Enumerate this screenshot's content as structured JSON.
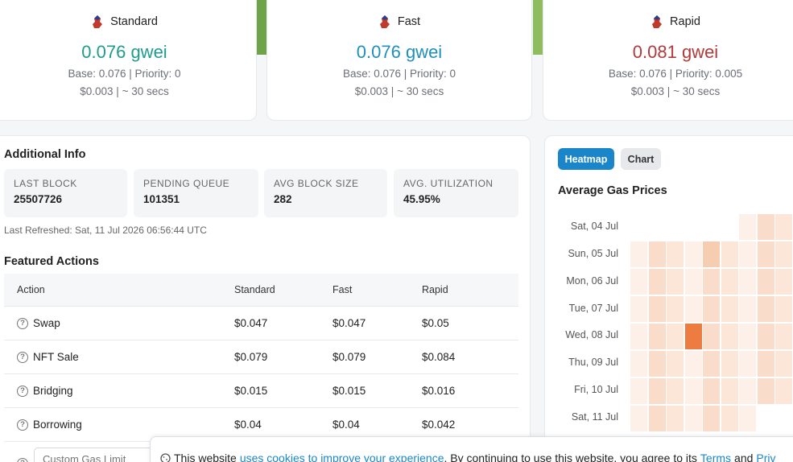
{
  "gas_cards": [
    {
      "name": "Standard",
      "price": "0.076 gwei",
      "base": "Base: 0.076 | Priority: 0",
      "usd": "$0.003 | ~ 30 secs",
      "color": "#1f9c8e"
    },
    {
      "name": "Fast",
      "price": "0.076 gwei",
      "base": "Base: 0.076 | Priority: 0",
      "usd": "$0.003 | ~ 30 secs",
      "color": "#1f8fbf"
    },
    {
      "name": "Rapid",
      "price": "0.081 gwei",
      "base": "Base: 0.076 | Priority: 0.005",
      "usd": "$0.003 | ~ 30 secs",
      "color": "#b23a3a"
    }
  ],
  "additional_info": {
    "title": "Additional Info",
    "stats": [
      {
        "label": "LAST BLOCK",
        "value": "25507726"
      },
      {
        "label": "PENDING QUEUE",
        "value": "101351"
      },
      {
        "label": "AVG BLOCK SIZE",
        "value": "282"
      },
      {
        "label": "AVG. UTILIZATION",
        "value": "45.95%"
      }
    ],
    "last_refreshed": "Last Refreshed: Sat, 11 Jul 2026 06:56:44 UTC"
  },
  "featured_actions": {
    "title": "Featured Actions",
    "columns": [
      "Action",
      "Standard",
      "Fast",
      "Rapid"
    ],
    "rows": [
      {
        "action": "Swap",
        "standard": "$0.047",
        "fast": "$0.047",
        "rapid": "$0.05"
      },
      {
        "action": "NFT Sale",
        "standard": "$0.079",
        "fast": "$0.079",
        "rapid": "$0.084"
      },
      {
        "action": "Bridging",
        "standard": "$0.015",
        "fast": "$0.015",
        "rapid": "$0.016"
      },
      {
        "action": "Borrowing",
        "standard": "$0.04",
        "fast": "$0.04",
        "rapid": "$0.042"
      }
    ],
    "custom_placeholder": "Custom Gas Limit"
  },
  "heatmap": {
    "tabs": [
      "Heatmap",
      "Chart"
    ],
    "active_tab": "Heatmap",
    "title": "Average Gas Prices",
    "days": [
      "Sat, 04 Jul",
      "Sun, 05 Jul",
      "Mon, 06 Jul",
      "Tue, 07 Jul",
      "Wed, 08 Jul",
      "Thu, 09 Jul",
      "Fri, 10 Jul",
      "Sat, 11 Jul"
    ]
  },
  "cookie": {
    "prefix": "This website",
    "link1": "uses cookies to improve your experience",
    "middle": ". By continuing to use this website, you agree to its",
    "link2": "Terms",
    "and": "and",
    "link3": "Priv"
  }
}
